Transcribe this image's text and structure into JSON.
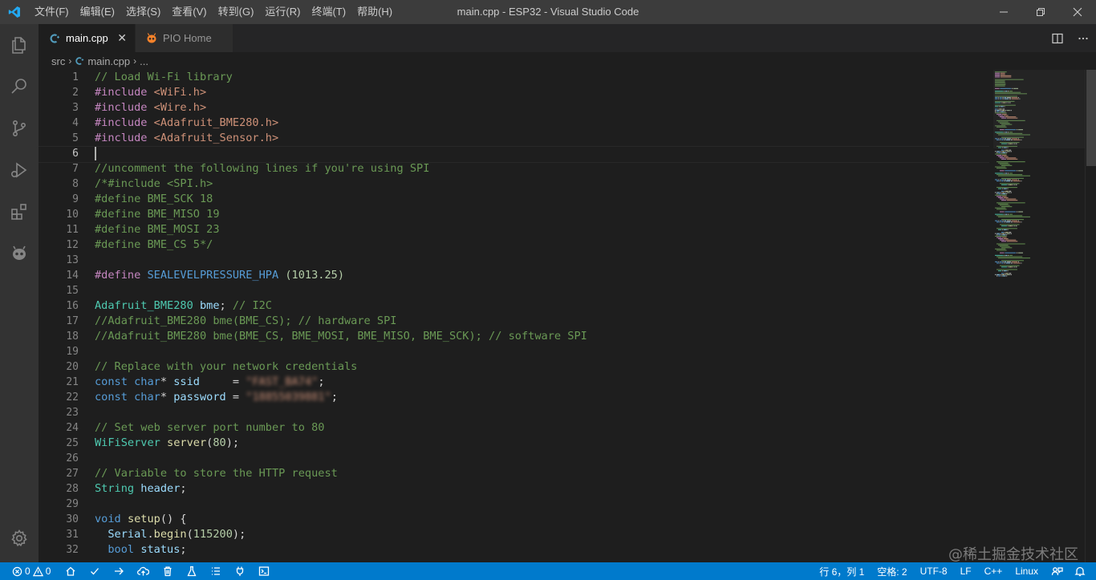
{
  "window": {
    "title": "main.cpp - ESP32 - Visual Studio Code",
    "menu": [
      "文件(F)",
      "编辑(E)",
      "选择(S)",
      "查看(V)",
      "转到(G)",
      "运行(R)",
      "终端(T)",
      "帮助(H)"
    ]
  },
  "activity_bar": {
    "items": [
      "explorer-icon",
      "search-icon",
      "source-control-icon",
      "run-debug-icon",
      "extensions-icon",
      "platformio-icon"
    ],
    "bottom": "settings-gear-icon"
  },
  "tabs": [
    {
      "label": "main.cpp",
      "icon": "cpp-file-icon",
      "active": true
    },
    {
      "label": "PIO Home",
      "icon": "platformio-icon",
      "active": false
    }
  ],
  "breadcrumb": {
    "folder": "src",
    "file": "main.cpp",
    "symbol": "..."
  },
  "editor": {
    "line_numbers": [
      "1",
      "2",
      "3",
      "4",
      "5",
      "6",
      "7",
      "8",
      "9",
      "10",
      "11",
      "12",
      "13",
      "14",
      "15",
      "16",
      "17",
      "18",
      "19",
      "20",
      "21",
      "22",
      "23",
      "24",
      "25",
      "26",
      "27",
      "28",
      "29",
      "30",
      "31",
      "32"
    ],
    "current_line": 6,
    "lines": [
      [
        {
          "t": "com",
          "s": "// Load Wi-Fi library"
        }
      ],
      [
        {
          "t": "pre",
          "s": "#include "
        },
        {
          "t": "str",
          "s": "<WiFi.h>"
        }
      ],
      [
        {
          "t": "pre",
          "s": "#include "
        },
        {
          "t": "str",
          "s": "<Wire.h>"
        }
      ],
      [
        {
          "t": "pre",
          "s": "#include "
        },
        {
          "t": "str",
          "s": "<Adafruit_BME280.h>"
        }
      ],
      [
        {
          "t": "pre",
          "s": "#include "
        },
        {
          "t": "str",
          "s": "<Adafruit_Sensor.h>"
        }
      ],
      [],
      [
        {
          "t": "com",
          "s": "//uncomment the following lines if you're using SPI"
        }
      ],
      [
        {
          "t": "com",
          "s": "/*#include <SPI.h>"
        }
      ],
      [
        {
          "t": "com",
          "s": "#define BME_SCK 18"
        }
      ],
      [
        {
          "t": "com",
          "s": "#define BME_MISO 19"
        }
      ],
      [
        {
          "t": "com",
          "s": "#define BME_MOSI 23"
        }
      ],
      [
        {
          "t": "com",
          "s": "#define BME_CS 5*/"
        }
      ],
      [],
      [
        {
          "t": "pre",
          "s": "#define "
        },
        {
          "t": "mac",
          "s": "SEALEVELPRESSURE_HPA"
        },
        {
          "t": "op",
          "s": " "
        },
        {
          "t": "num",
          "s": "(1013.25)"
        }
      ],
      [],
      [
        {
          "t": "typ",
          "s": "Adafruit_BME280"
        },
        {
          "t": "op",
          "s": " "
        },
        {
          "t": "var",
          "s": "bme"
        },
        {
          "t": "op",
          "s": "; "
        },
        {
          "t": "com",
          "s": "// I2C"
        }
      ],
      [
        {
          "t": "com",
          "s": "//Adafruit_BME280 bme(BME_CS); // hardware SPI"
        }
      ],
      [
        {
          "t": "com",
          "s": "//Adafruit_BME280 bme(BME_CS, BME_MOSI, BME_MISO, BME_SCK); // software SPI"
        }
      ],
      [],
      [
        {
          "t": "com",
          "s": "// Replace with your network credentials"
        }
      ],
      [
        {
          "t": "kw",
          "s": "const"
        },
        {
          "t": "op",
          "s": " "
        },
        {
          "t": "kw",
          "s": "char"
        },
        {
          "t": "op",
          "s": "* "
        },
        {
          "t": "var",
          "s": "ssid"
        },
        {
          "t": "op",
          "s": "     = "
        },
        {
          "t": "blur",
          "s": "\"FAST_BA74\""
        },
        {
          "t": "op",
          "s": ";"
        }
      ],
      [
        {
          "t": "kw",
          "s": "const"
        },
        {
          "t": "op",
          "s": " "
        },
        {
          "t": "kw",
          "s": "char"
        },
        {
          "t": "op",
          "s": "* "
        },
        {
          "t": "var",
          "s": "password"
        },
        {
          "t": "op",
          "s": " = "
        },
        {
          "t": "blur",
          "s": "\"18855039881\""
        },
        {
          "t": "op",
          "s": ";"
        }
      ],
      [],
      [
        {
          "t": "com",
          "s": "// Set web server port number to 80"
        }
      ],
      [
        {
          "t": "typ",
          "s": "WiFiServer"
        },
        {
          "t": "op",
          "s": " "
        },
        {
          "t": "fn",
          "s": "server"
        },
        {
          "t": "op",
          "s": "("
        },
        {
          "t": "num",
          "s": "80"
        },
        {
          "t": "op",
          "s": ");"
        }
      ],
      [],
      [
        {
          "t": "com",
          "s": "// Variable to store the HTTP request"
        }
      ],
      [
        {
          "t": "typ",
          "s": "String"
        },
        {
          "t": "op",
          "s": " "
        },
        {
          "t": "var",
          "s": "header"
        },
        {
          "t": "op",
          "s": ";"
        }
      ],
      [],
      [
        {
          "t": "kw",
          "s": "void"
        },
        {
          "t": "op",
          "s": " "
        },
        {
          "t": "fn",
          "s": "setup"
        },
        {
          "t": "op",
          "s": "() {"
        }
      ],
      [
        {
          "t": "op",
          "s": "  "
        },
        {
          "t": "var",
          "s": "Serial"
        },
        {
          "t": "op",
          "s": "."
        },
        {
          "t": "fn",
          "s": "begin"
        },
        {
          "t": "op",
          "s": "("
        },
        {
          "t": "num",
          "s": "115200"
        },
        {
          "t": "op",
          "s": ");"
        }
      ],
      [
        {
          "t": "op",
          "s": "  "
        },
        {
          "t": "kw",
          "s": "bool"
        },
        {
          "t": "op",
          "s": " "
        },
        {
          "t": "var",
          "s": "status"
        },
        {
          "t": "op",
          "s": ";"
        }
      ]
    ]
  },
  "status_bar": {
    "errors": "0",
    "warnings": "0",
    "left_icons": [
      "home-icon",
      "check-icon",
      "arrow-right-icon",
      "cloud-upload-icon",
      "trash-icon",
      "flask-icon",
      "list-icon",
      "plug-icon",
      "terminal-icon"
    ],
    "cursor_position": "行 6，列 1",
    "indent": "空格: 2",
    "encoding": "UTF-8",
    "eol": "LF",
    "language": "C++",
    "os": "Linux",
    "right_icons": [
      "feedback-icon",
      "bell-icon"
    ]
  },
  "watermark": "@稀土掘金技术社区"
}
